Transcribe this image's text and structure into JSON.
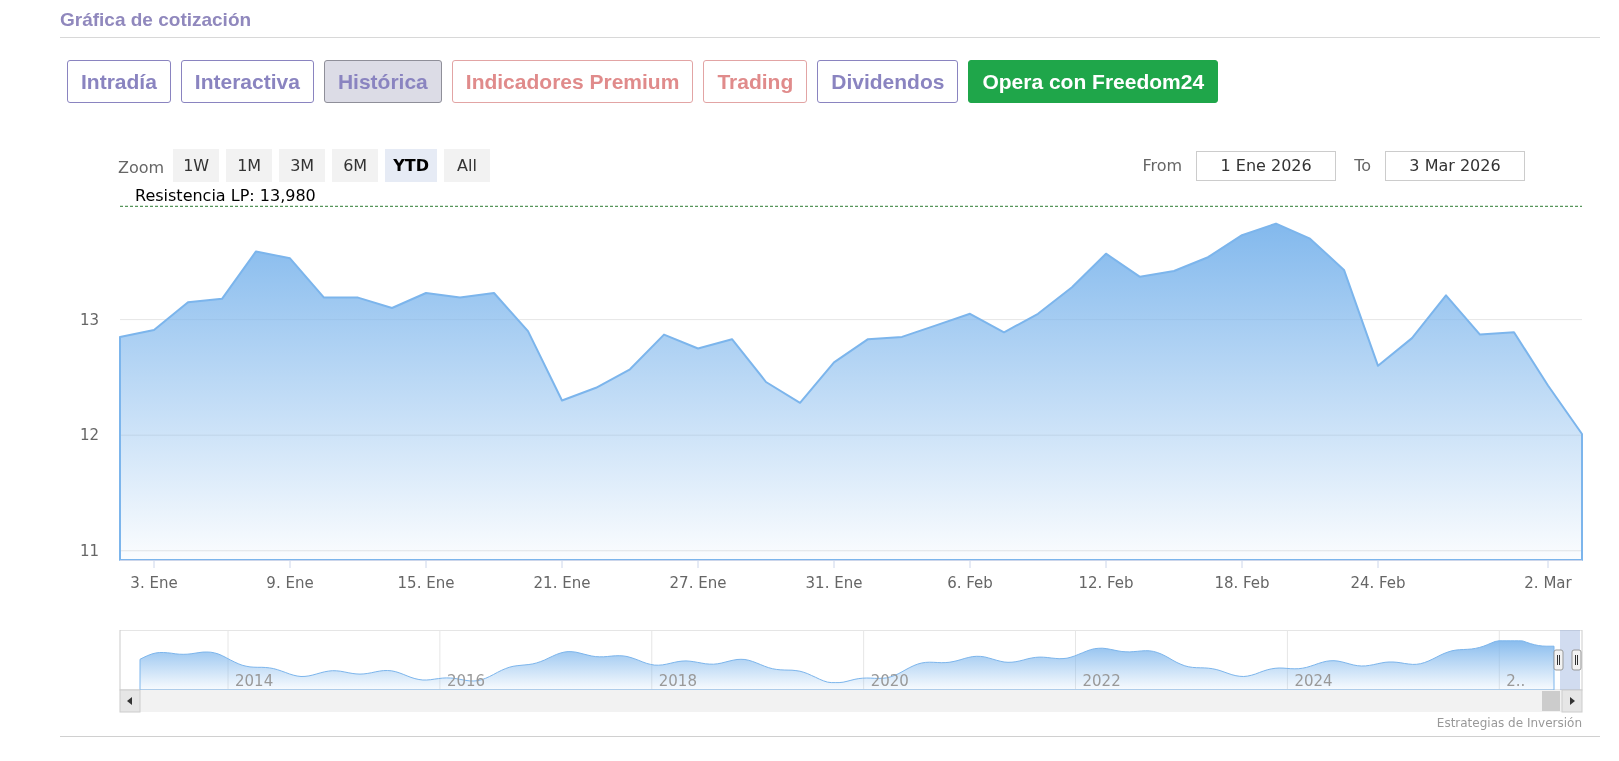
{
  "section": {
    "title": "Gráfica de cotización"
  },
  "tabs": [
    {
      "label": "Intradía",
      "kind": "normal",
      "selected": false
    },
    {
      "label": "Interactiva",
      "kind": "normal",
      "selected": false
    },
    {
      "label": "Histórica",
      "kind": "normal",
      "selected": true
    },
    {
      "label": "Indicadores Premium",
      "kind": "premium",
      "selected": false
    },
    {
      "label": "Trading",
      "kind": "premium",
      "selected": false
    },
    {
      "label": "Dividendos",
      "kind": "normal",
      "selected": false
    },
    {
      "label": "Opera con Freedom24",
      "kind": "cta",
      "selected": false
    }
  ],
  "range_selector": {
    "label": "Zoom",
    "buttons": [
      {
        "label": "1W",
        "selected": false
      },
      {
        "label": "1M",
        "selected": false
      },
      {
        "label": "3M",
        "selected": false
      },
      {
        "label": "6M",
        "selected": false
      },
      {
        "label": "YTD",
        "selected": true
      },
      {
        "label": "All",
        "selected": false
      }
    ],
    "from_label": "From",
    "from_value": "1 Ene 2026",
    "to_label": "To",
    "to_value": "3 Mar 2026"
  },
  "chart": {
    "chart_data": {
      "type": "area",
      "categories": [
        null,
        "3. Ene",
        null,
        null,
        null,
        "9. Ene",
        null,
        null,
        null,
        "15. Ene",
        null,
        null,
        null,
        "21. Ene",
        null,
        null,
        null,
        "27. Ene",
        null,
        null,
        null,
        "31. Ene",
        null,
        null,
        null,
        "6. Feb",
        null,
        null,
        null,
        "12. Feb",
        null,
        null,
        null,
        "18. Feb",
        null,
        null,
        null,
        "24. Feb",
        null,
        null,
        null,
        null,
        "2. Mar",
        null
      ],
      "series": [
        {
          "color": "#7cb5ec",
          "values": [
            12.85,
            12.91,
            13.15,
            13.18,
            13.59,
            13.53,
            13.19,
            13.19,
            13.1,
            13.23,
            13.19,
            13.23,
            12.9,
            12.3,
            12.41,
            12.57,
            12.87,
            12.75,
            12.83,
            12.46,
            12.28,
            12.63,
            12.83,
            12.85,
            12.95,
            13.05,
            12.89,
            13.05,
            13.28,
            13.57,
            13.37,
            13.42,
            13.54,
            13.73,
            13.83,
            13.7,
            13.43,
            12.6,
            12.84,
            13.21,
            12.87,
            12.89,
            12.43,
            12.01
          ]
        }
      ],
      "ylim": [
        10.92,
        14
      ],
      "yticks": [
        11,
        12,
        13
      ],
      "grid": true,
      "ref_lines": [
        {
          "axis": "y",
          "value": 13.98,
          "label": "Resistencia LP: 13,980"
        }
      ]
    }
  },
  "navigator": {
    "year_labels": [
      "2014",
      "2016",
      "2018",
      "2020",
      "2022",
      "2024",
      "2.."
    ]
  },
  "credit": "Estrategias de Inversión"
}
